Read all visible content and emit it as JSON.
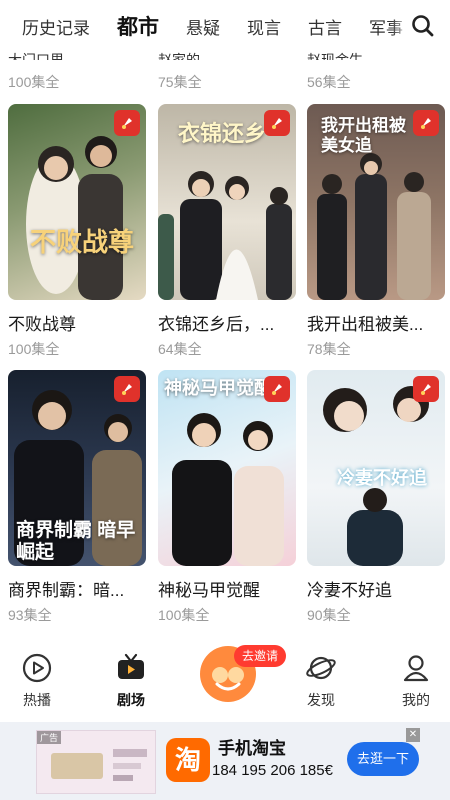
{
  "tabs": [
    {
      "label": "历史记录",
      "active": false
    },
    {
      "label": "都市",
      "active": true
    },
    {
      "label": "悬疑",
      "active": false
    },
    {
      "label": "现言",
      "active": false
    },
    {
      "label": "古言",
      "active": false
    },
    {
      "label": "军事",
      "active": false
    }
  ],
  "partial_row": [
    {
      "title": "大门口里",
      "episodes": "100集全"
    },
    {
      "title": "赵家的",
      "episodes": "75集全"
    },
    {
      "title": "赵现金生",
      "episodes": "56集全"
    }
  ],
  "dramas": [
    {
      "title": "不败战尊",
      "episodes": "100集全",
      "poster_text": "不败战尊",
      "colors": [
        "#5d7a4a",
        "#d9c9a8"
      ]
    },
    {
      "title": "衣锦还乡后，...",
      "episodes": "64集全",
      "poster_text": "衣锦还乡",
      "colors": [
        "#c9c2b4",
        "#f3efe6"
      ]
    },
    {
      "title": "我开出租被美...",
      "episodes": "78集全",
      "poster_text": "我开出租被美女追",
      "colors": [
        "#5b4a46",
        "#a88a76"
      ]
    },
    {
      "title": "商界制霸：暗...",
      "episodes": "93集全",
      "poster_text": "商界制霸 暗早崛起",
      "colors": [
        "#1c2433",
        "#3c4a63"
      ]
    },
    {
      "title": "神秘马甲觉醒",
      "episodes": "100集全",
      "poster_text": "神秘马甲觉醒",
      "colors": [
        "#cfeaf6",
        "#f6d7de"
      ]
    },
    {
      "title": "冷妻不好追",
      "episodes": "90集全",
      "poster_text": "冷妻不好追",
      "colors": [
        "#dde8ee",
        "#f3f6f8"
      ]
    }
  ],
  "bottom_nav": {
    "items": [
      {
        "label": "热播",
        "icon": "play-circle-icon",
        "active": false
      },
      {
        "label": "剧场",
        "icon": "tv-icon",
        "active": true
      },
      {
        "label": "发现",
        "icon": "planet-icon",
        "active": false
      },
      {
        "label": "我的",
        "icon": "user-icon",
        "active": false
      }
    ],
    "invite_label": "去邀请"
  },
  "ad": {
    "tag": "广告",
    "title": "手机淘宝",
    "phone": "184 195 206 185€",
    "logo": "淘",
    "cta": "去逛一下",
    "close": "✕"
  },
  "colors": {
    "accent_red": "#e0322b",
    "invite_red": "#ff3b30",
    "center_orange": "#ff8a3d",
    "ad_blue": "#1f6feb"
  }
}
